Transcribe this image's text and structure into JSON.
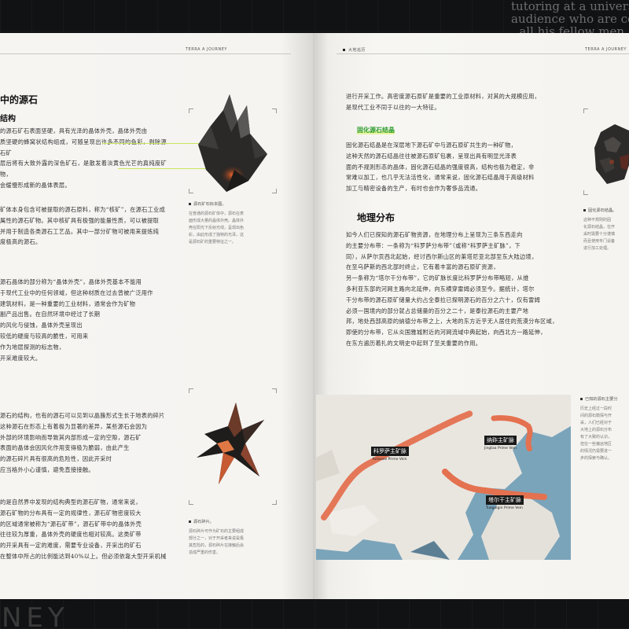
{
  "background": {
    "caption_lines": [
      "tutoring at a university",
      "audience who are con",
      "all his fellow men"
    ],
    "logo_text": "NEY"
  },
  "left_page": {
    "running_head": "TERRA A JOURNEY",
    "title": "中的源石",
    "subtitle": "结构",
    "paragraphs": [
      "的源石矿石表面坚硬，具有光泽的晶体外壳，晶体外壳由\n质坚硬的蜂窝状结构组成，可随呈现出许多不同的色彩，剥除源石矿\n层后将有大致外露的深色矿石，是散发着淡黄色光芒的真纯度矿物，\n会缓慢形成新的晶体表层。",
      "矿体本身包含可被提取的源石原料，称为“核矿”，在源石工业成\n属性的源石矿物。其中核矿具有极强的能量性质，可以被提取\n并用于制造各类源石工艺品。其中一部分矿物可被用来提炼纯\n度极高的源石。",
      "源石晶体的部分称为“晶体外壳”，晶体外壳基本不能用\n于现代工业中的任何领域，但这种材质在过去曾被广泛用作\n建筑材料，是一种重要的工业材料，通常会作为矿物\n副产品出售。在自然环境中经过了长期\n的风化与侵蚀，晶体外壳呈现出\n较低的硬度与较高的脆性，可用来\n作为地层探测的标志物，\n开采难度较大。",
      "源石的结构，也有的源石可以见到以晶簇形式生长于地表的碎片\n这种源石在形态上有着极为显著的差异，某些源石会因为\n外部的环境影响而导致其内部形成一定的空隙，源石矿\n表面的晶体会因风化作用变得极为脆弱，由此产生\n的源石碎片具有很高的危险性，因此开采时\n应当格外小心谨慎，避免直接接触。",
      "的是自然界中发现的结构典型的源石矿物，通常来说，\n源石矿物的分布具有一定的规律性，源石矿物密度较大\n的区域通常被称为“源石矿带”，源石矿带中的晶体外壳\n往往较为厚重，晶体外壳的硬度也相对较高。这类矿带\n的开采具有一定的难度，需要专业设备，开采出的矿石\n在整体中所占的比例能达到40%以上。但必须依靠大型开采机械"
    ],
    "figure1": {
      "caption_title": "源石矿石标本图。",
      "caption_text": "在普通的源石矿体中，源石在表\n面形成大量的晶体外壳。晶体外\n壳在阳光下反射光线，呈现出色\n彩，由此形成了独特的光泽，这\n是源石矿的重要特征之一。"
    },
    "figure2": {
      "caption_title": "源石碎片。",
      "caption_text": "源石碎片可作为矿石的主要组成\n部分之一，对于开采者来说是极\n其危险的，源石碎片在接触后会\n造成严重的伤害。"
    }
  },
  "right_page": {
    "running_head_left": "大地巡历",
    "running_head_right": "TERRA A JOURNEY",
    "intro_paragraph": "进行开采工作。高密度源石原矿是重要的工业原材料，对其的大规模应用，\n是现代工业不同于以往的一大特征。",
    "green_heading": "固化源石结晶",
    "paragraph_2": "固化源石结晶是在深层地下源石矿中与源石原矿共生的一种矿物，\n这种天然的源石结晶往往被源石原矿包裹，呈现出具有明显光泽表\n面的不规则形态的晶体，固化源石结晶的强度很高，结构也极为稳定，非\n常难以加工，也几乎无法活性化，通常来说，固化源石结晶用于高级材料\n加工与精密设备的生产，有时也会作为奢侈品流通。",
    "section_heading": "地理分布",
    "paragraph_3": "如今人们已探知的源石矿物资源，在地理分布上呈现为三条东西走向\n的主要分布带：一条称为“科罗萨分布带”（或称“科罗萨主矿脉”，下\n同），从萨尔贡西北起始，经讨西尔斯山区的莱塔尼亚北部至东大陆边境，\n在至乌萨斯的西北部时终止，它有着丰富的源石原矿资源，\n另一条称为“塔尔干分布带”，它的矿脉长度比科罗萨分布带略短，从维\n多利亚东部的河网主路向北延伸，向东横穿雷姆必须至今。据统计，塔尔\n干分布带的源石原矿储量大约占全泰拉已探明源石的百分之六十，仅有雷姆\n必须一国境内的部分就占总储量的百分之二十，是泰拉源石的主要产地\n邦，地处西部高原的纳德分布带之上，大地的东方近乎无人居住的荒漠分布区域，\n即使的分布带，它从炎国雅城附近的河网流域中典起始，向西北方一路延伸，\n在东方遍历着扎的文明史中起到了至关重要的作用。",
    "figure_caption": {
      "title": "固化源石结晶。",
      "text": "这种不规则的固\n化源石结晶，在开\n采时需要十分谨慎\n而且使用专门设备\n进行加工处理。"
    },
    "map_caption": {
      "title": "已知的源石主要分",
      "text": "历史上经过一段时\n间的源石勘探与开\n采，人们已经对于\n大地上的源石分布\n有了大致的认识，\n但在一些偏远地区\n的情况仍需要进一\n步的探索与确认。"
    },
    "map_labels": [
      {
        "title": "科罗萨主矿脉",
        "sub": "Kolossai Prime Vein"
      },
      {
        "title": "纳砟主矿脉",
        "sub": "Jingtaa Prime Vein"
      },
      {
        "title": "塔尔干主矿脉",
        "sub": "Tuegalgin Prime Vein"
      }
    ]
  },
  "colors": {
    "vein": "#e4714f",
    "highlight": "#c6e65a",
    "green_heading": "#2a9a2a",
    "map_water": "#7aa4ba",
    "map_land": "#e9e6e0"
  }
}
